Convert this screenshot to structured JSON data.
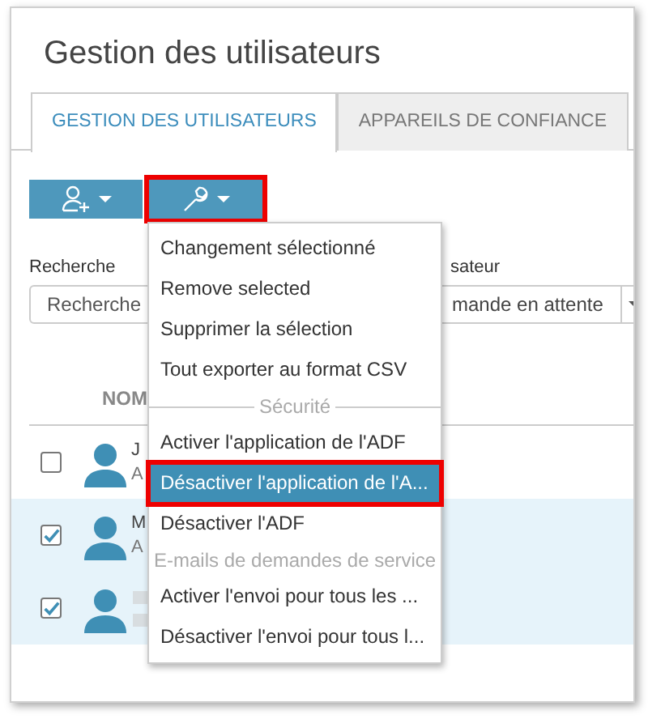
{
  "title": "Gestion des utilisateurs",
  "tabs": [
    {
      "label": "GESTION DES UTILISATEURS",
      "selected": true
    },
    {
      "label": "APPAREILS DE CONFIANCE",
      "selected": false
    }
  ],
  "toolbar": [
    {
      "kind": "add-user",
      "highlighted": false
    },
    {
      "kind": "tools",
      "highlighted": true
    }
  ],
  "filters": {
    "search": {
      "label": "Recherche",
      "placeholder": "Recherche"
    },
    "user": {
      "label": "sateur",
      "value": "mande en attente"
    }
  },
  "menu": [
    {
      "kind": "item",
      "label": "Changement sélectionné",
      "selected": false
    },
    {
      "kind": "item",
      "label": "Remove selected",
      "selected": false
    },
    {
      "kind": "item",
      "label": "Supprimer la sélection",
      "selected": false
    },
    {
      "kind": "item",
      "label": "Tout exporter au format CSV",
      "selected": false
    },
    {
      "kind": "header",
      "label": "Sécurité"
    },
    {
      "kind": "item",
      "label": "Activer l'application de l'ADF",
      "selected": false
    },
    {
      "kind": "item",
      "label": "Désactiver l'application de l'A...",
      "selected": true
    },
    {
      "kind": "item",
      "label": "Désactiver l'ADF",
      "selected": false
    },
    {
      "kind": "header",
      "label": "E-mails de demandes de service"
    },
    {
      "kind": "item",
      "label": "Activer l'envoi pour tous les ...",
      "selected": false
    },
    {
      "kind": "item",
      "label": "Désactiver l'envoi pour tous l...",
      "selected": false
    }
  ],
  "table": {
    "columns": [
      "NOM"
    ],
    "rows": [
      {
        "checked": false,
        "selected": false,
        "name": "J",
        "detail": "A"
      },
      {
        "checked": true,
        "selected": true,
        "name": "M",
        "detail": "A"
      },
      {
        "checked": true,
        "selected": true,
        "redacted": true
      }
    ]
  }
}
